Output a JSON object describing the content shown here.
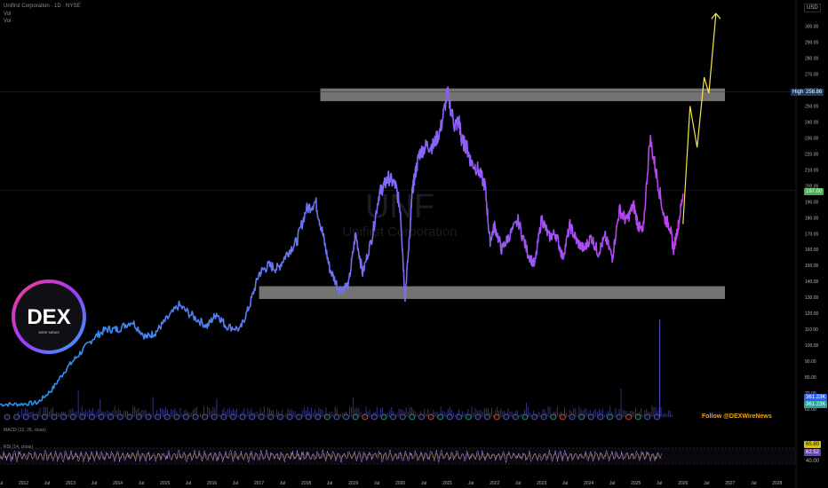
{
  "header": {
    "symbol_line": "Unifirst Corporation · 1D · NYSE",
    "line2": "Vol",
    "line3": "Vol"
  },
  "currency_label": "USD",
  "watermark": {
    "ticker": "UNF",
    "name": "Unifirst Corporation"
  },
  "high_marker": {
    "label": "High",
    "value": "258.86"
  },
  "last_price": {
    "value": "197.00"
  },
  "volume_labels": {
    "a": "361.23K",
    "b": "361.23K"
  },
  "indicators": {
    "macd_label": "MACD (12, 26, close)",
    "rsi_label": "RSI (14, close)",
    "rsi_value": "65.80",
    "rsi_ma_value": "62.52",
    "rsi_level": "40.00"
  },
  "logo": {
    "text": "DEX",
    "subtext": "WIRE NEWS"
  },
  "follow_text": "Follow @DEXWireNews",
  "colors": {
    "background": "#000000",
    "price_start": "#2196f3",
    "price_end": "#c040f0",
    "projection": "#f5e64a",
    "zone": "#9a9a9a",
    "last_price_bg": "#4caf50",
    "high_bg": "#1e3a5f",
    "rsi_line": "#b388ff",
    "volume": "#5b5fdc"
  },
  "chart_data": {
    "type": "line",
    "title": "Unifirst Corporation · 1D · NYSE",
    "ylabel": "USD",
    "ylim": [
      55,
      312
    ],
    "y_ticks": [
      60,
      70,
      80,
      90,
      100,
      110,
      120,
      130,
      140,
      150,
      160,
      170,
      180,
      190,
      200,
      210,
      220,
      230,
      240,
      250,
      260,
      270,
      280,
      290,
      300
    ],
    "x_tick_labels": [
      "Jul",
      "2012",
      "Jul",
      "2013",
      "Jul",
      "2014",
      "Jul",
      "2015",
      "Jul",
      "2016",
      "Jul",
      "2017",
      "Jul",
      "2018",
      "Jul",
      "2019",
      "Jul",
      "2020",
      "Jul",
      "2021",
      "Jul",
      "2022",
      "Jul",
      "2023",
      "Jul",
      "2024",
      "Jul",
      "2025",
      "Jul",
      "2026",
      "Jul",
      "2027",
      "Jul",
      "2028"
    ],
    "x_tick_values": [
      2011.5,
      2012,
      2012.5,
      2013,
      2013.5,
      2014,
      2014.5,
      2015,
      2015.5,
      2016,
      2016.5,
      2017,
      2017.5,
      2018,
      2018.5,
      2019,
      2019.5,
      2020,
      2020.5,
      2021,
      2021.5,
      2022,
      2022.5,
      2023,
      2023.5,
      2024,
      2024.5,
      2025,
      2025.5,
      2026,
      2026.5,
      2027,
      2027.5,
      2028
    ],
    "xlim": [
      2011.5,
      2028.4
    ],
    "grid": false,
    "series": [
      {
        "x": [
          2011.5,
          2011.9,
          2012.3,
          2012.6,
          2012.9,
          2013.2,
          2013.5,
          2013.75,
          2014.0,
          2014.3,
          2014.6,
          2014.8,
          2015.0,
          2015.3,
          2015.6,
          2015.9,
          2016.1,
          2016.3,
          2016.6,
          2016.8,
          2017.0,
          2017.2,
          2017.4,
          2017.6,
          2017.8,
          2018.0,
          2018.2,
          2018.35,
          2018.5,
          2018.7,
          2018.9,
          2019.05,
          2019.2,
          2019.4,
          2019.55,
          2019.65,
          2019.75,
          2019.9,
          2020.0,
          2020.1,
          2020.2,
          2020.25,
          2020.3,
          2020.4,
          2020.55,
          2020.7,
          2020.85,
          2021.0,
          2021.15,
          2021.25,
          2021.3,
          2021.4,
          2021.5,
          2021.65,
          2021.8,
          2021.9,
          2022.0,
          2022.15,
          2022.3,
          2022.5,
          2022.7,
          2022.85,
          2023.0,
          2023.15,
          2023.3,
          2023.45,
          2023.6,
          2023.75,
          2023.9,
          2024.05,
          2024.2,
          2024.35,
          2024.5,
          2024.65,
          2024.8,
          2024.95,
          2025.05,
          2025.15,
          2025.3,
          2025.45,
          2025.6,
          2025.72,
          2025.8,
          2025.9,
          2026.0
        ],
        "y": [
          63,
          63,
          64,
          72,
          85,
          95,
          105,
          110,
          110,
          115,
          105,
          108,
          115,
          125,
          118,
          112,
          120,
          112,
          110,
          125,
          145,
          150,
          148,
          158,
          165,
          185,
          190,
          170,
          148,
          135,
          138,
          170,
          145,
          168,
          195,
          200,
          205,
          200,
          185,
          130,
          170,
          195,
          205,
          220,
          225,
          225,
          235,
          258,
          238,
          240,
          228,
          225,
          215,
          210,
          200,
          165,
          175,
          160,
          168,
          178,
          158,
          150,
          180,
          168,
          170,
          155,
          175,
          165,
          160,
          168,
          158,
          168,
          155,
          185,
          178,
          188,
          175,
          170,
          230,
          205,
          180,
          175,
          160,
          175,
          195
        ]
      }
    ],
    "projection": {
      "x": [
        2026.0,
        2026.15,
        2026.3,
        2026.45,
        2026.55,
        2026.7
      ],
      "y": [
        176,
        250,
        224,
        268,
        258,
        308
      ]
    },
    "zones": [
      {
        "y_bottom": 253,
        "y_top": 261,
        "x_start": 2018.3,
        "x_end": 2028.4
      },
      {
        "y_bottom": 129,
        "y_top": 137,
        "x_start": 2017.0,
        "x_end": 2028.4
      }
    ],
    "high_level": 258.86,
    "last_value": 197.0
  }
}
